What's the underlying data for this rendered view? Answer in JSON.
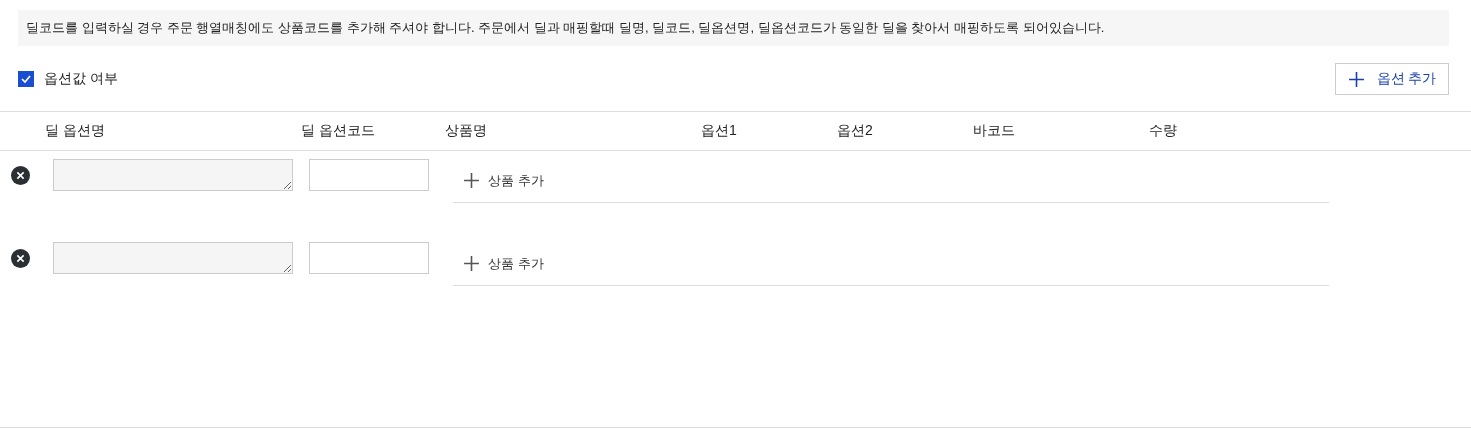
{
  "notice": "딜코드를 입력하실 경우 주문 행열매칭에도 상품코드를 추가해 주셔야 합니다. 주문에서 딜과 매핑할때 딜명, 딜코드, 딜옵션명, 딜옵션코드가 동일한 딜을 찾아서 매핑하도록 되어있습니다.",
  "option_toggle": {
    "label": "옵션값 여부",
    "checked": true
  },
  "add_option_button": {
    "label": "옵션 추가"
  },
  "columns": [
    "딜 옵션명",
    "딜 옵션코드",
    "상품명",
    "옵션1",
    "옵션2",
    "바코드",
    "수량"
  ],
  "rows": [
    {
      "add_product_label": "상품 추가"
    },
    {
      "add_product_label": "상품 추가"
    }
  ]
}
